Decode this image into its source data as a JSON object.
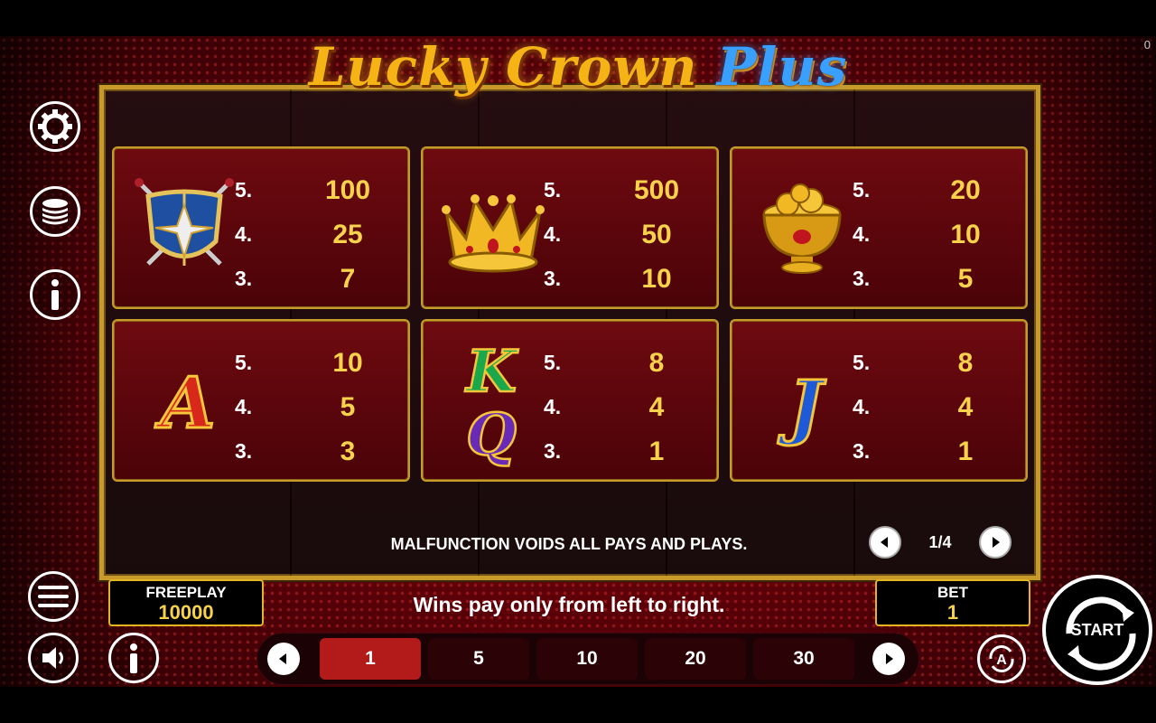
{
  "game": {
    "title_part1": "Lucky Crown",
    "title_part2": "Plus",
    "corner_counter": "0"
  },
  "paytable": {
    "cards": [
      {
        "symbol": "shield-swords-icon",
        "rows": [
          {
            "count": "5.",
            "pay": "100"
          },
          {
            "count": "4.",
            "pay": "25"
          },
          {
            "count": "3.",
            "pay": "7"
          }
        ]
      },
      {
        "symbol": "crown-icon",
        "rows": [
          {
            "count": "5.",
            "pay": "500"
          },
          {
            "count": "4.",
            "pay": "50"
          },
          {
            "count": "3.",
            "pay": "10"
          }
        ]
      },
      {
        "symbol": "gold-coin-bowl-icon",
        "rows": [
          {
            "count": "5.",
            "pay": "20"
          },
          {
            "count": "4.",
            "pay": "10"
          },
          {
            "count": "3.",
            "pay": "5"
          }
        ]
      },
      {
        "symbol": "letter-a-icon",
        "letter": "A",
        "rows": [
          {
            "count": "5.",
            "pay": "10"
          },
          {
            "count": "4.",
            "pay": "5"
          },
          {
            "count": "3.",
            "pay": "3"
          }
        ]
      },
      {
        "symbol": "letters-kq-icon",
        "letter_top": "K",
        "letter_bottom": "Q",
        "rows": [
          {
            "count": "5.",
            "pay": "8"
          },
          {
            "count": "4.",
            "pay": "4"
          },
          {
            "count": "3.",
            "pay": "1"
          }
        ]
      },
      {
        "symbol": "letter-j-icon",
        "letter": "J",
        "rows": [
          {
            "count": "5.",
            "pay": "8"
          },
          {
            "count": "4.",
            "pay": "4"
          },
          {
            "count": "3.",
            "pay": "1"
          }
        ]
      }
    ],
    "malfunction_notice": "MALFUNCTION VOIDS ALL PAYS AND PLAYS.",
    "page_indicator": "1/4"
  },
  "footer": {
    "freeplay_label": "FREEPLAY",
    "freeplay_value": "10000",
    "bet_label": "BET",
    "bet_value": "1",
    "wins_text": "Wins pay only from left to right.",
    "bet_options": [
      "1",
      "5",
      "10",
      "20",
      "30"
    ],
    "selected_bet": "1",
    "start_label": "START",
    "auto_label": "A"
  },
  "colors": {
    "gold": "#f7d24a",
    "frame_gold": "#c89a2a",
    "card_red": "#6e0a10",
    "active_bet": "#b31a1a",
    "title_blue": "#3aa0ff"
  }
}
